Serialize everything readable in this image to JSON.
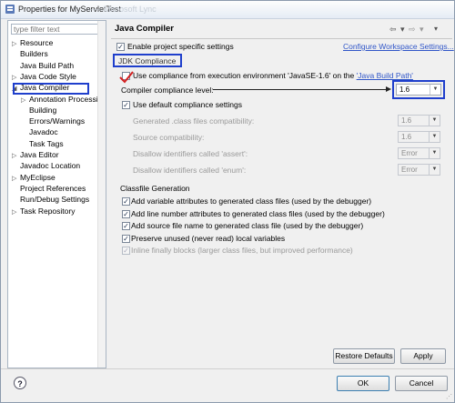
{
  "window": {
    "title": "Properties for MyServletTest",
    "ghost_title": "——Microsoft Lync"
  },
  "filter": {
    "placeholder": "type filter text"
  },
  "tree": [
    {
      "label": "Resource",
      "arrow": "▷",
      "indent": 0
    },
    {
      "label": "Builders",
      "arrow": "",
      "indent": 0
    },
    {
      "label": "Java Build Path",
      "arrow": "",
      "indent": 0
    },
    {
      "label": "Java Code Style",
      "arrow": "▷",
      "indent": 0
    },
    {
      "label": "Java Compiler",
      "arrow": "◢",
      "indent": 0
    },
    {
      "label": "Annotation Processin",
      "arrow": "▷",
      "indent": 1
    },
    {
      "label": "Building",
      "arrow": "",
      "indent": 1
    },
    {
      "label": "Errors/Warnings",
      "arrow": "",
      "indent": 1
    },
    {
      "label": "Javadoc",
      "arrow": "",
      "indent": 1
    },
    {
      "label": "Task Tags",
      "arrow": "",
      "indent": 1
    },
    {
      "label": "Java Editor",
      "arrow": "▷",
      "indent": 0
    },
    {
      "label": "Javadoc Location",
      "arrow": "",
      "indent": 0
    },
    {
      "label": "MyEclipse",
      "arrow": "▷",
      "indent": 0
    },
    {
      "label": "Project References",
      "arrow": "",
      "indent": 0
    },
    {
      "label": "Run/Debug Settings",
      "arrow": "",
      "indent": 0
    },
    {
      "label": "Task Repository",
      "arrow": "▷",
      "indent": 0
    }
  ],
  "page": {
    "title": "Java Compiler",
    "enable_project": "Enable project specific settings",
    "configure_link": "Configure Workspace Settings...",
    "jdk_group": "JDK Compliance",
    "use_compliance_pre": "Use compliance from execution environment 'JavaSE-1.6' on the ",
    "use_compliance_link": "'Java Build Path'",
    "compliance_level_label": "Compiler compliance level:",
    "compliance_level_value": "1.6",
    "use_default": "Use default compliance settings",
    "generated_label": "Generated .class files compatibility:",
    "generated_value": "1.6",
    "source_label": "Source compatibility:",
    "source_value": "1.6",
    "assert_label": "Disallow identifiers called 'assert':",
    "assert_value": "Error",
    "enum_label": "Disallow identifiers called 'enum':",
    "enum_value": "Error",
    "classfile_group": "Classfile Generation",
    "cf1": "Add variable attributes to generated class files (used by the debugger)",
    "cf2": "Add line number attributes to generated class files (used by the debugger)",
    "cf3": "Add source file name to generated class file (used by the debugger)",
    "cf4": "Preserve unused (never read) local variables",
    "cf5": "Inline finally blocks (larger class files, but improved performance)"
  },
  "buttons": {
    "restore": "Restore Defaults",
    "apply": "Apply",
    "ok": "OK",
    "cancel": "Cancel",
    "help": "?"
  },
  "nav": {
    "back": "⇦",
    "dd": "▾",
    "fwd": "⇨",
    "dd2": "▾"
  },
  "colors": {
    "annotation": "#1f3fcc",
    "check_red": "#d32020",
    "link": "#3056c8"
  }
}
